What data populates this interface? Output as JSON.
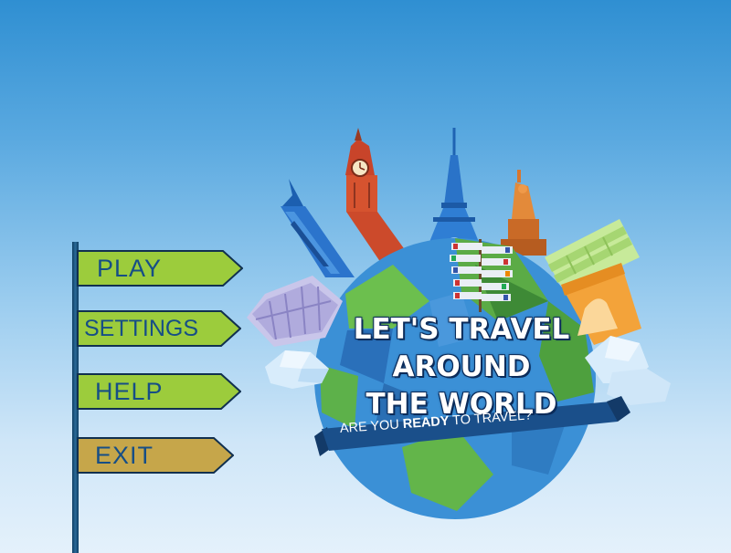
{
  "menu": {
    "items": [
      {
        "label": "PLAY",
        "color": "#9ccc3c"
      },
      {
        "label": "SETTINGS",
        "color": "#9ccc3c"
      },
      {
        "label": "HELP",
        "color": "#9ccc3c"
      },
      {
        "label": "EXIT",
        "color": "#c6a64a"
      }
    ]
  },
  "title": {
    "line1": "LET'S TRAVEL",
    "line2": "AROUND",
    "line3": "THE WORLD"
  },
  "tagline": {
    "part1": "ARE YOU ",
    "part2": "READY",
    "part3": " TO TRAVEL?"
  },
  "colors": {
    "sky_top": "#2f8fd2",
    "sky_bottom": "#e4f1fb",
    "sign_text": "#164e86",
    "globe_blue": "#3b90d6",
    "globe_green": "#68b84a",
    "ribbon": "#1a4f8a"
  }
}
